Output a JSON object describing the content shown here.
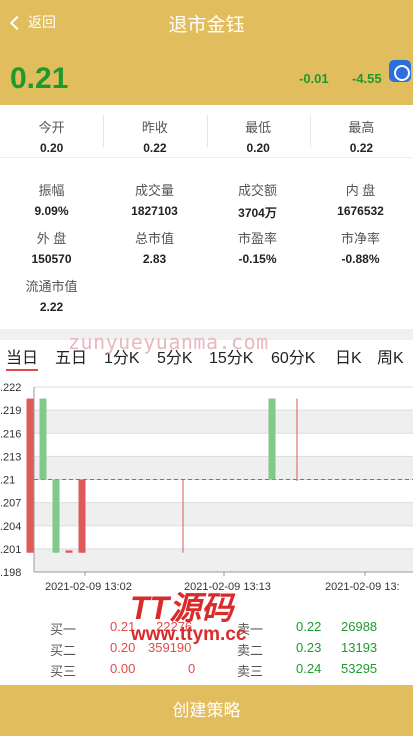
{
  "header": {
    "back_label": "返回",
    "title": "退市金钰"
  },
  "price": {
    "current": "0.21",
    "change": "-0.01",
    "change_pct": "-4.55"
  },
  "quote_top": [
    {
      "label": "今开",
      "value": "0.20"
    },
    {
      "label": "昨收",
      "value": "0.22"
    },
    {
      "label": "最低",
      "value": "0.20"
    },
    {
      "label": "最高",
      "value": "0.22"
    }
  ],
  "quote_detail": [
    {
      "label": "振幅",
      "value": "9.09%"
    },
    {
      "label": "成交量",
      "value": "1827103"
    },
    {
      "label": "成交额",
      "value": "3704万"
    },
    {
      "label": "内 盘",
      "value": "1676532"
    },
    {
      "label": "外 盘",
      "value": "150570"
    },
    {
      "label": "总市值",
      "value": "2.83"
    },
    {
      "label": "市盈率",
      "value": "-0.15%"
    },
    {
      "label": "市净率",
      "value": "-0.88%"
    },
    {
      "label": "流通市值",
      "value": "2.22"
    }
  ],
  "tabs": [
    "当日",
    "五日",
    "1分K",
    "5分K",
    "15分K",
    "60分K",
    "日K",
    "周K"
  ],
  "watermark": {
    "url": "zunyueyuanma.com",
    "brand": "TT源码",
    "site": "www.ttym.cc"
  },
  "chart_data": {
    "type": "candlestick",
    "y_ticks": [
      ".222",
      ".219",
      ".216",
      ".213",
      ".21",
      ".207",
      ".204",
      ".201",
      ".198"
    ],
    "ylim": [
      0.198,
      0.222
    ],
    "x_ticks": [
      "2021-02-09 13:02",
      "2021-02-09 13:13",
      "2021-02-09 13:"
    ],
    "reference_line": 0.21,
    "candles": [
      {
        "open": 0.2205,
        "close": 0.2005,
        "high": 0.2205,
        "low": 0.2005,
        "color": "red"
      },
      {
        "open": 0.2205,
        "close": 0.21,
        "high": 0.2205,
        "low": 0.21,
        "color": "green"
      },
      {
        "open": 0.21,
        "close": 0.2005,
        "high": 0.21,
        "low": 0.2005,
        "color": "green"
      },
      {
        "open": 0.2005,
        "close": 0.2008,
        "high": 0.2008,
        "low": 0.2005,
        "color": "red"
      },
      {
        "open": 0.2005,
        "close": 0.21,
        "high": 0.21,
        "low": 0.2005,
        "color": "red"
      },
      {
        "open": 0.21,
        "close": 0.21,
        "high": 0.21,
        "low": 0.2005,
        "color": "red"
      },
      {
        "open": 0.21,
        "close": 0.2205,
        "high": 0.2205,
        "low": 0.21,
        "color": "green"
      },
      {
        "open": 0.21,
        "close": 0.21,
        "high": 0.2205,
        "low": 0.21,
        "color": "red"
      }
    ],
    "colors": {
      "red": "#e05a5a",
      "green": "#7fc98a",
      "ref": "#e34a4a"
    }
  },
  "order_book": [
    {
      "buy_label": "买一",
      "buy_price": "0.21",
      "buy_vol": "22276",
      "sell_label": "卖一",
      "sell_price": "0.22",
      "sell_vol": "26988"
    },
    {
      "buy_label": "买二",
      "buy_price": "0.20",
      "buy_vol": "359190",
      "sell_label": "卖二",
      "sell_price": "0.23",
      "sell_vol": "13193"
    },
    {
      "buy_label": "买三",
      "buy_price": "0.00",
      "buy_vol": "0",
      "sell_label": "卖三",
      "sell_price": "0.24",
      "sell_vol": "53295"
    }
  ],
  "footer": {
    "label": "创建策略"
  },
  "colors": {
    "brand": "#e2bd5d",
    "down": "#1e9a2c",
    "up": "#e34a4a"
  }
}
